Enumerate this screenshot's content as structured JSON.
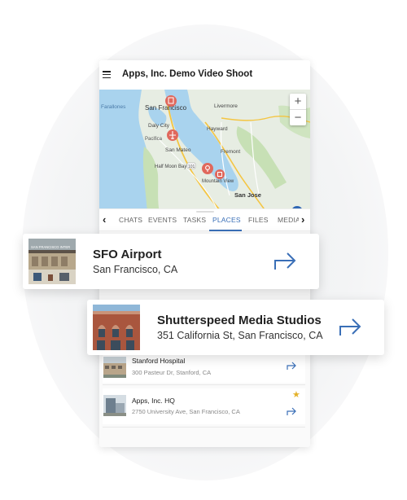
{
  "app": {
    "title": "Apps, Inc. Demo Video Shoot"
  },
  "map": {
    "labels": {
      "sf": "San Francisco",
      "dalycity": "Daly City",
      "sanmateo": "San Mateo",
      "hayward": "Hayward",
      "livermore": "Livermore",
      "fremont": "Fremont",
      "halfmoon": "Half Moon Bay",
      "mountainview": "Mountain View",
      "sanjose": "San Jose",
      "farallones": "Farallones",
      "pacifica": "Pacifica",
      "road101": "101"
    },
    "zoom_in": "+",
    "zoom_out": "−",
    "pin_colors": {
      "place": "#e0685c",
      "locate": "#2f66b3"
    }
  },
  "tabs": {
    "prev": "‹",
    "next": "›",
    "items": [
      {
        "label": "CHATS",
        "active": false
      },
      {
        "label": "EVENTS",
        "active": false
      },
      {
        "label": "TASKS",
        "active": false
      },
      {
        "label": "PLACES",
        "active": true
      },
      {
        "label": "FILES",
        "active": false
      },
      {
        "label": "MEDIA",
        "active": false
      }
    ]
  },
  "places": [
    {
      "name": "SFO Airport",
      "address": "San Francisco, CA",
      "thumb_sign": "SAN FRANCISCO INTER",
      "icon": "arrow-forward-icon"
    },
    {
      "name": "Shutterspeed Media Studios",
      "address": "351 California St, San Francisco, CA",
      "icon": "arrow-forward-icon"
    },
    {
      "name": "Stanford Hospital",
      "address": "300 Pasteur Dr, Stanford, CA",
      "icon": "arrow-forward-icon"
    },
    {
      "name": "Apps, Inc. HQ",
      "address": "2750 University Ave, San Francisco, CA",
      "icon": "arrow-forward-icon",
      "starred": true
    }
  ],
  "colors": {
    "accent": "#3a6fb7",
    "star": "#e4b229"
  }
}
